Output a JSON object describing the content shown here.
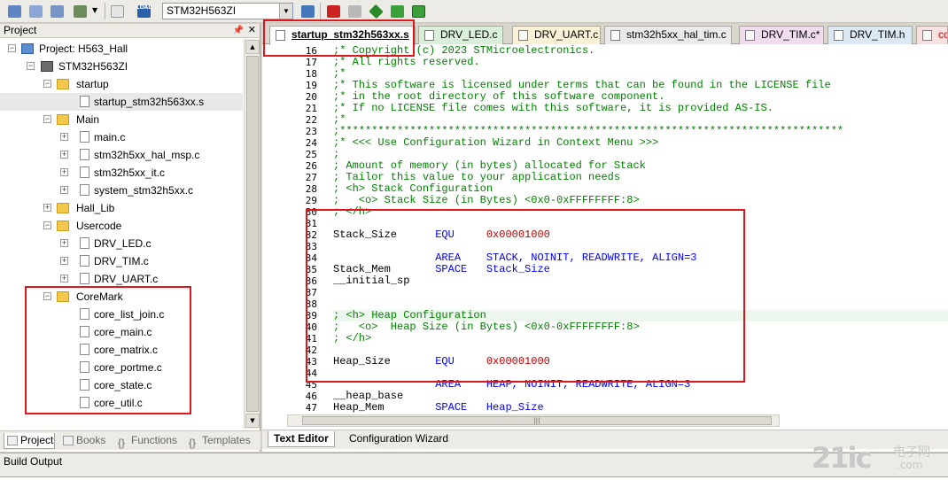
{
  "toolbar": {
    "target_value": "STM32H563ZI",
    "load_label": "LOAD",
    "colors": {
      "accent_green": "#2a8a2a",
      "accent_red": "#cc2222"
    }
  },
  "project_panel": {
    "title": "Project",
    "pin_icon": "pin-icon",
    "close_icon": "close-icon",
    "tree": {
      "project": "Project: H563_Hall",
      "target": "STM32H563ZI",
      "groups": [
        {
          "name": "startup",
          "files": [
            "startup_stm32h563xx.s"
          ]
        },
        {
          "name": "Main",
          "files": [
            "main.c",
            "stm32h5xx_hal_msp.c",
            "stm32h5xx_it.c",
            "system_stm32h5xx.c"
          ]
        },
        {
          "name": "Hall_Lib",
          "files": []
        },
        {
          "name": "Usercode",
          "files": [
            "DRV_LED.c",
            "DRV_TIM.c",
            "DRV_UART.c"
          ]
        },
        {
          "name": "CoreMark",
          "files": [
            "core_list_join.c",
            "core_main.c",
            "core_matrix.c",
            "core_portme.c",
            "core_state.c",
            "core_util.c"
          ]
        }
      ]
    },
    "tabs": [
      "Project",
      "Books",
      "Functions",
      "Templates"
    ]
  },
  "editor": {
    "tabs": [
      "startup_stm32h563xx.s",
      "DRV_LED.c",
      "DRV_UART.c",
      "stm32h5xx_hal_tim.c",
      "DRV_TIM.c*",
      "DRV_TIM.h",
      "co"
    ],
    "line_numbers": [
      "16",
      "17",
      "18",
      "19",
      "20",
      "21",
      "22",
      "23",
      "24",
      "25",
      "26",
      "27",
      "28",
      "29",
      "30",
      "31",
      "32",
      "33",
      "34",
      "35",
      "36",
      "37",
      "38",
      "39",
      "40",
      "41",
      "42",
      "43",
      "44",
      "45",
      "46",
      "47"
    ],
    "lines": [
      ";* Copyright (c) 2023 STMicroelectronics.",
      ";* All rights reserved.",
      ";*",
      ";* This software is licensed under terms that can be found in the LICENSE file",
      ";* in the root directory of this software component.",
      ";* If no LICENSE file comes with this software, it is provided AS-IS.",
      ";*",
      ";*******************************************************************************",
      ";* <<< Use Configuration Wizard in Context Menu >>>",
      ";",
      "; Amount of memory (in bytes) allocated for Stack",
      "; Tailor this value to your application needs",
      "; <h> Stack Configuration",
      ";   <o> Stack Size (in Bytes) <0x0-0xFFFFFFFF:8>",
      "; </h>",
      "",
      [
        "Stack_Size      ",
        "EQU",
        "     ",
        "0x00001000"
      ],
      "",
      [
        "                ",
        "AREA",
        "    ",
        "STACK, NOINIT, READWRITE, ALIGN=3"
      ],
      [
        "Stack_Mem       ",
        "SPACE",
        "   ",
        "Stack_Size"
      ],
      "__initial_sp",
      "",
      "",
      "; <h> Heap Configuration",
      ";   <o>  Heap Size (in Bytes) <0x0-0xFFFFFFFF:8>",
      "; </h>",
      "",
      [
        "Heap_Size       ",
        "EQU",
        "     ",
        "0x00001000"
      ],
      "",
      [
        "                ",
        "AREA",
        "    ",
        "HEAP, NOINIT, READWRITE, ALIGN=3"
      ],
      "__heap_base",
      [
        "Heap_Mem        ",
        "SPACE",
        "   ",
        "Heap_Size"
      ]
    ],
    "bottom_tabs": [
      "Text Editor",
      "Configuration Wizard"
    ]
  },
  "build_output": {
    "title": "Build Output"
  },
  "watermark": {
    "big": "21ic",
    "cn": "电子网",
    "com": ".com"
  },
  "colors": {
    "comment": "#008000",
    "keyword": "#0000ff",
    "number": "#c00000",
    "highlight_box": "#e0161c"
  }
}
